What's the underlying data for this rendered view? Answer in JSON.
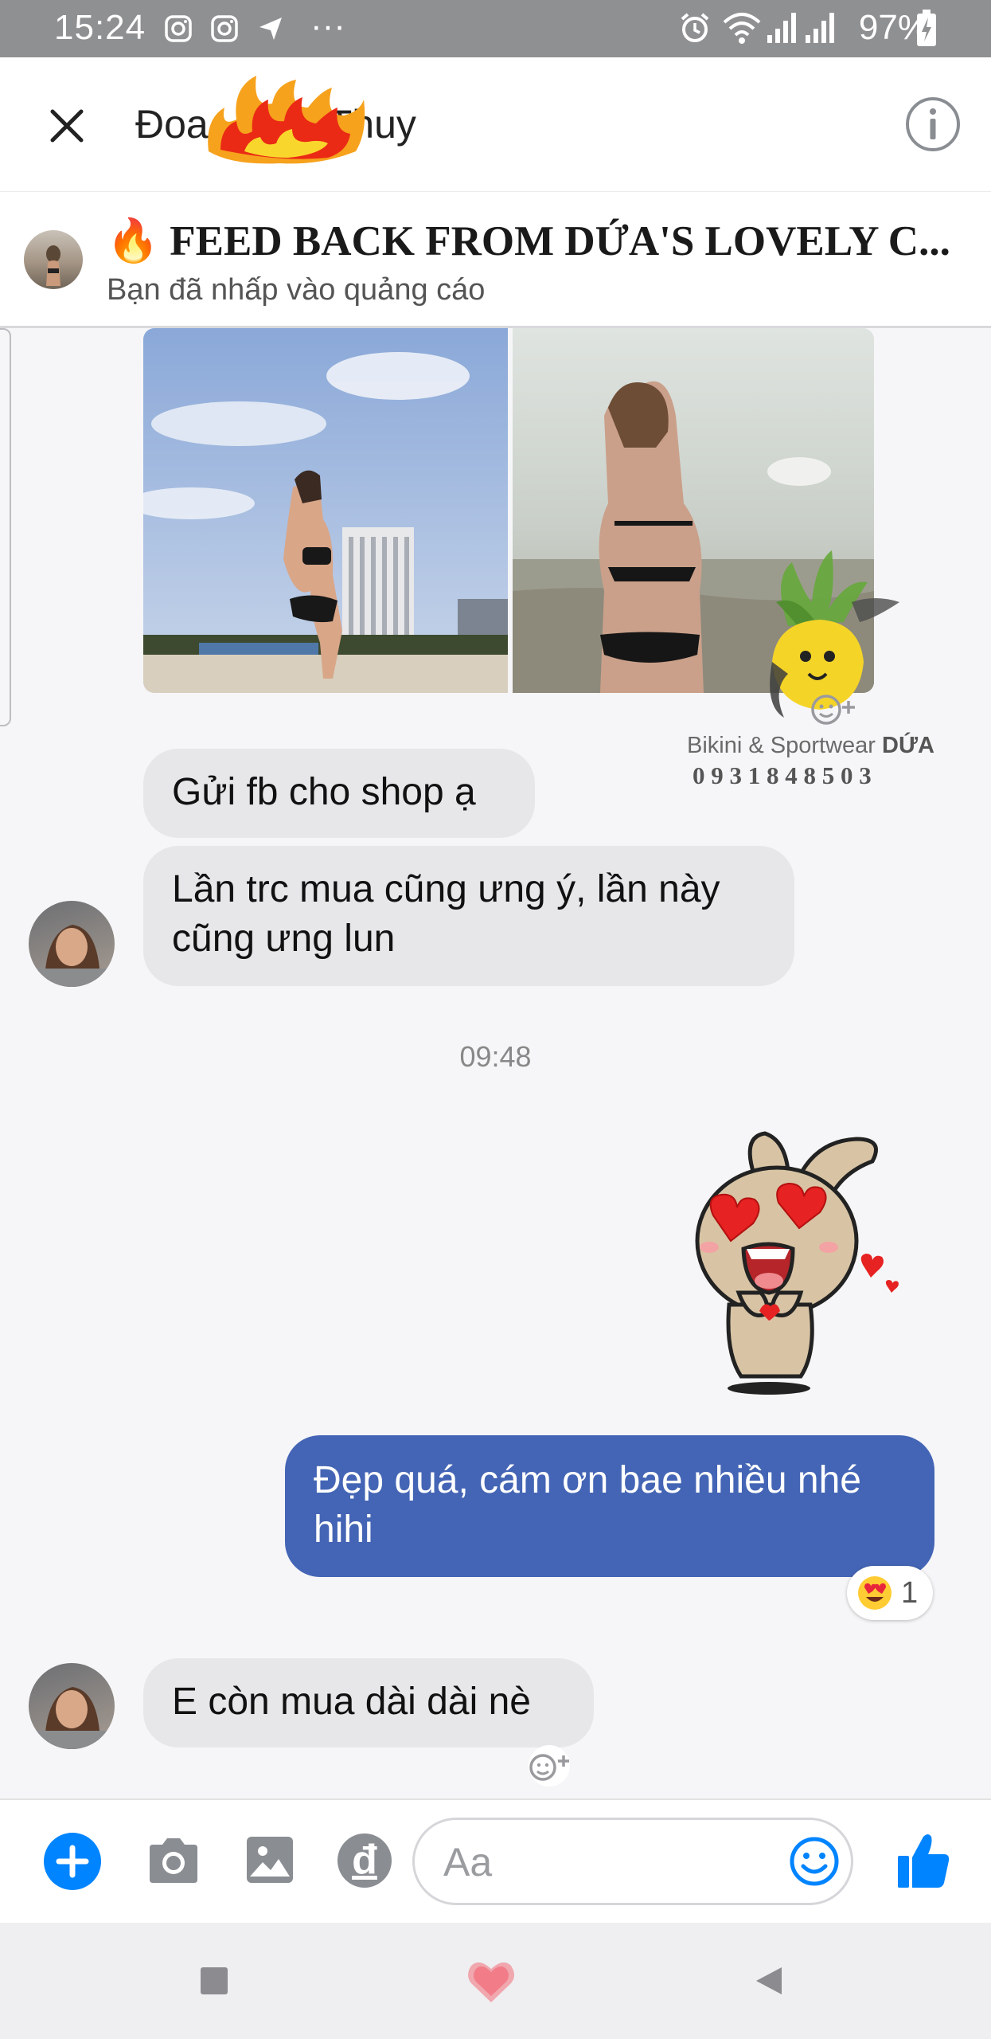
{
  "status_bar": {
    "time": "15:24",
    "battery": "97%",
    "overflow": "···"
  },
  "header": {
    "contact_name_start": "Đoa",
    "contact_name_end": "Thuy"
  },
  "ad": {
    "title": "🔥 FEED BACK FROM DỨA'S LOVELY C...",
    "subtitle": "Bạn đã nhấp vào quảng cáo"
  },
  "watermark": {
    "brand_prefix": "Bikini & Sportwear ",
    "brand_name": "DỨA",
    "phone": "0 9 3 1 8 4 8 5 0 3"
  },
  "messages": {
    "m1": "Gửi fb cho shop ạ",
    "m2_line1": "Lần trc mua cũng ưng ý, lần này",
    "m2_line2": "cũng ưng lun",
    "timestamp": "09:48",
    "m3_line1": "Đẹp quá, cám ơn bae nhiều nhé",
    "m3_line2": "hihi",
    "reaction_count": "1",
    "m4": "E còn mua dài dài nè"
  },
  "composer": {
    "placeholder": "Aa",
    "dong_symbol": "đ"
  },
  "colors": {
    "accent": "#0084ff",
    "outgoing_bubble": "#4465b5",
    "incoming_bubble": "#e7e7ea",
    "status_bar": "#8f9092"
  },
  "icons": [
    "instagram-icon",
    "camera-icon",
    "location-icon",
    "alarm-icon",
    "wifi-icon",
    "signal-icon",
    "battery-icon",
    "close-icon",
    "info-icon",
    "fire-icon",
    "add-emoji-icon",
    "plus-icon",
    "photo-icon",
    "smiley-icon",
    "like-icon",
    "recent-apps-icon",
    "home-icon",
    "back-icon"
  ]
}
